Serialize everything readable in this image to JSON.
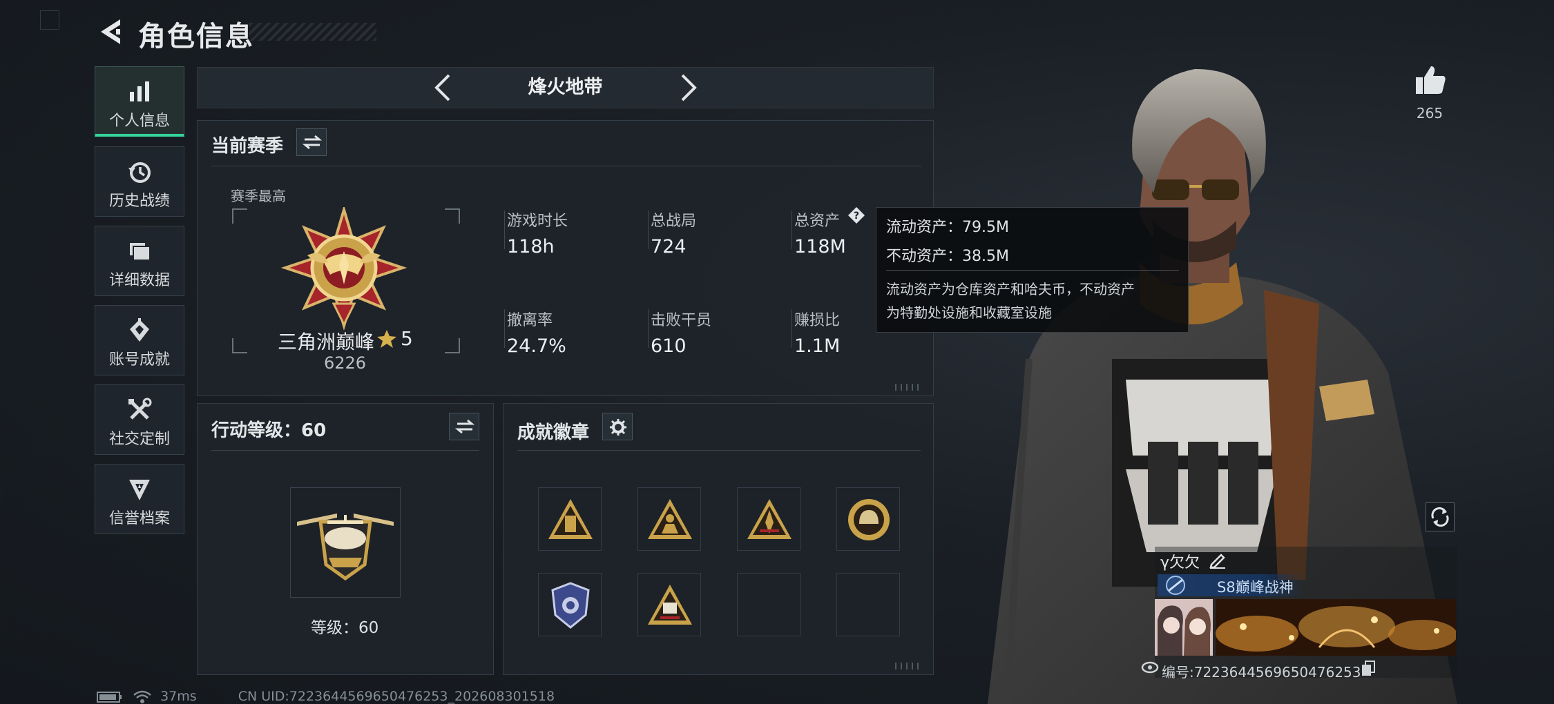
{
  "header": {
    "title": "角色信息"
  },
  "sidebar": {
    "items": [
      {
        "label": "个人信息",
        "icon": "bar-chart-icon",
        "active": true
      },
      {
        "label": "历史战绩",
        "icon": "history-icon",
        "active": false
      },
      {
        "label": "详细数据",
        "icon": "folder-icon",
        "active": false
      },
      {
        "label": "账号成就",
        "icon": "achievement-icon",
        "active": false
      },
      {
        "label": "社交定制",
        "icon": "tools-icon",
        "active": false
      },
      {
        "label": "信誉档案",
        "icon": "reputation-icon",
        "active": false
      }
    ]
  },
  "mode_selector": {
    "label": "烽火地带"
  },
  "season": {
    "title": "当前赛季",
    "best_label": "赛季最高",
    "rank_name": "三角洲巅峰",
    "rank_stars": "5",
    "rank_score": "6226",
    "stats": [
      {
        "label": "游戏时长",
        "value": "118h"
      },
      {
        "label": "总战局",
        "value": "724"
      },
      {
        "label": "总资产",
        "value": "118M"
      },
      {
        "label": "撤离率",
        "value": "24.7%"
      },
      {
        "label": "击败干员",
        "value": "610"
      },
      {
        "label": "赚损比",
        "value": "1.1M"
      }
    ]
  },
  "tooltip": {
    "liquid": "流动资产：79.5M",
    "fixed": "不动资产：38.5M",
    "desc_line1": "流动资产为仓库资产和哈夫币，不动资产",
    "desc_line2": "为特勤处设施和收藏室设施"
  },
  "action_level": {
    "title": "行动等级：60",
    "level_text": "等级：60"
  },
  "badges": {
    "title": "成就徽章",
    "slots": [
      {
        "icon": "triangle-tower-badge-icon"
      },
      {
        "icon": "triangle-soldier-badge-icon"
      },
      {
        "icon": "triangle-rocket-badge-icon"
      },
      {
        "icon": "round-helmet-badge-icon"
      },
      {
        "icon": "police-shield-badge-icon"
      },
      {
        "icon": "triangle-s8-badge-icon"
      },
      {
        "icon": ""
      },
      {
        "icon": ""
      }
    ]
  },
  "like": {
    "count": "265"
  },
  "profile_card": {
    "name": "γ欠欠",
    "title": "S8巅峰战神",
    "id": "编号:7223644569650476253"
  },
  "status_bar": {
    "ping": "37ms",
    "uid": "CN UID:7223644569650476253_202608301518"
  },
  "colors": {
    "accent_green": "#36d39a",
    "gold": "#c9a24a",
    "panel_bg": "#1e242a"
  }
}
